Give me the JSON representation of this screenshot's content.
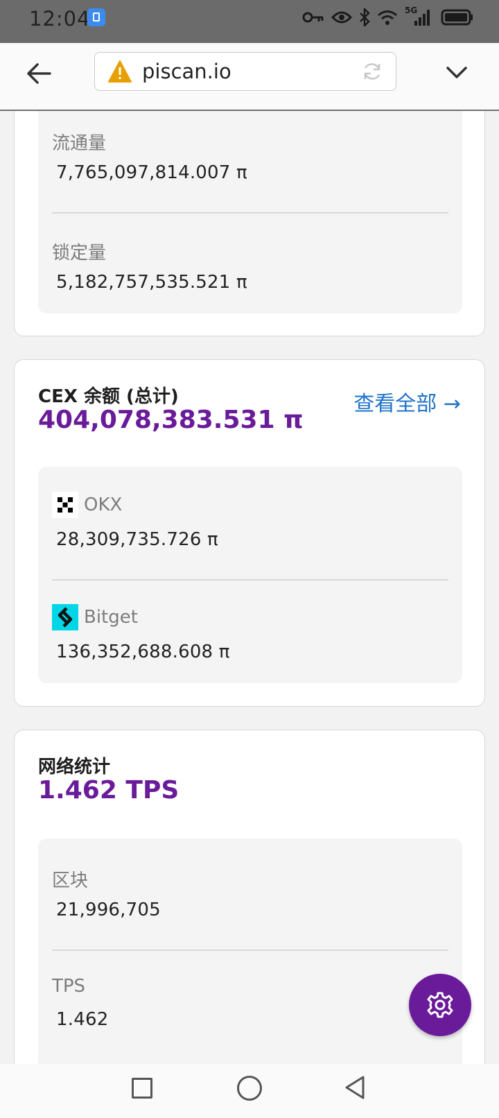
{
  "status_bar": {
    "time": "12:04",
    "network": "5G",
    "icons": [
      "app-badge-icon",
      "key-icon",
      "eye-icon",
      "bluetooth-icon",
      "wifi-icon",
      "signal-icon",
      "battery-icon"
    ]
  },
  "browser": {
    "url": "piscan.io",
    "icons": [
      "back-arrow-icon",
      "warning-icon",
      "reload-icon",
      "chevron-down-icon"
    ]
  },
  "supply": {
    "items": [
      {
        "label": "流通量",
        "value": "7,765,097,814.007 π"
      },
      {
        "label": "锁定量",
        "value": "5,182,757,535.521 π"
      }
    ]
  },
  "cex": {
    "title": "CEX 余额 (总计)",
    "total": "404,078,383.531 π",
    "view_all": "查看全部 →",
    "exchanges": [
      {
        "name": "OKX",
        "value": "28,309,735.726 π",
        "icon": "okx-logo-icon"
      },
      {
        "name": "Bitget",
        "value": "136,352,688.608 π",
        "icon": "bitget-logo-icon"
      }
    ]
  },
  "network": {
    "title": "网络统计",
    "headline": "1.462 TPS",
    "items": [
      {
        "label": "区块",
        "value": "21,996,705"
      },
      {
        "label": "TPS",
        "value": "1.462"
      }
    ]
  },
  "fab": {
    "icon": "settings-gear-icon"
  },
  "colors": {
    "accent": "#6a1b9a",
    "link": "#1e72c9",
    "warning": "#e8a000",
    "bitget": "#00d6e8"
  }
}
